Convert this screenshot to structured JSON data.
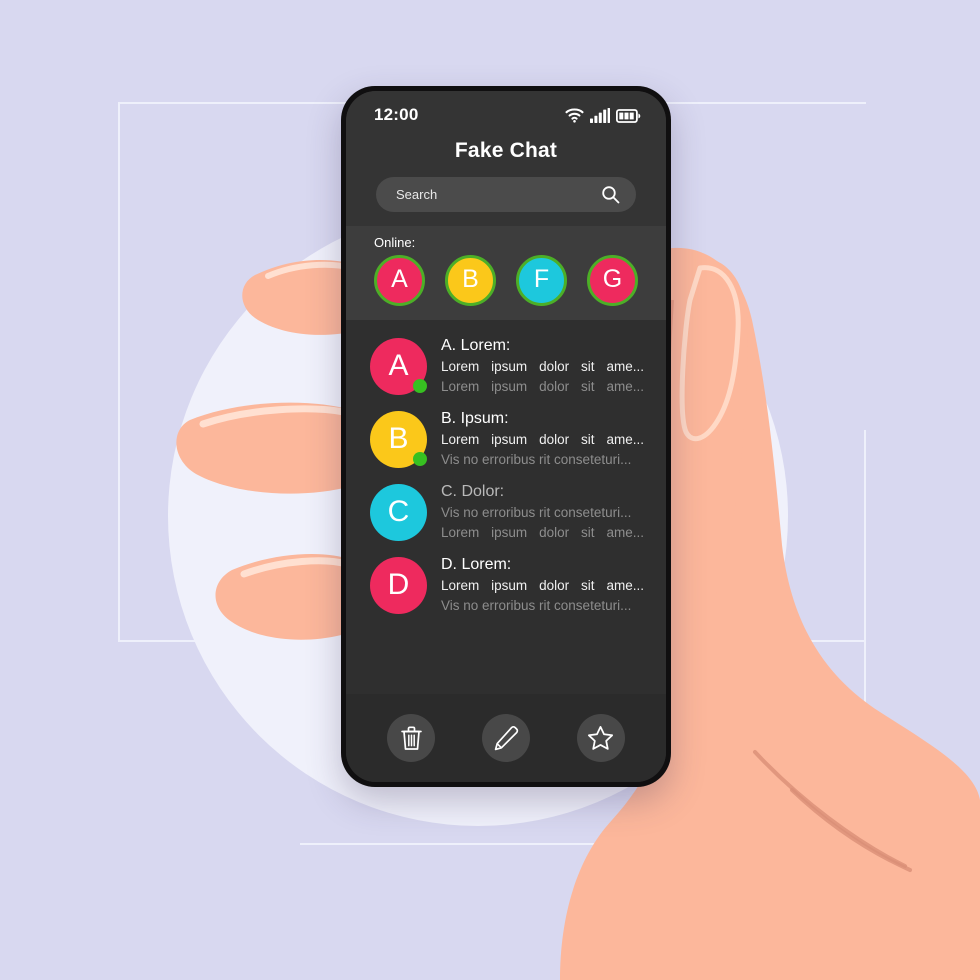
{
  "scene": {
    "background_color": "#d8d8f0",
    "circle_color": "#f0f1fb",
    "skin_color": "#fcb79b",
    "skin_shadow": "#f6a98c",
    "frame_line_color": "#eef0fb"
  },
  "phone": {
    "body_color": "#100f10",
    "screen_color": "#2f2f2f"
  },
  "statusbar": {
    "time": "12:00",
    "wifi_icon": "wifi-icon",
    "signal_icon": "signal-bars-icon",
    "battery_icon": "battery-icon"
  },
  "header": {
    "title": "Fake Chat",
    "background": "#343434"
  },
  "search": {
    "placeholder": "Search",
    "value": "",
    "icon": "search-icon"
  },
  "online": {
    "label": "Online:",
    "ring_color": "#4caf27",
    "avatars": [
      {
        "letter": "A",
        "color": "#ee2a5e"
      },
      {
        "letter": "B",
        "color": "#fbc81a"
      },
      {
        "letter": "F",
        "color": "#1dc8dd"
      },
      {
        "letter": "G",
        "color": "#ee2a5e"
      }
    ]
  },
  "chats": [
    {
      "letter": "A",
      "color": "#ee2a5e",
      "online": true,
      "title": "A. Lorem:",
      "unread": true,
      "line1": "Lorem ipsum dolor sit ame...",
      "line1_style": "strong",
      "line2": "Lorem ipsum dolor sit ame...",
      "line2_style": "dim",
      "justify1": true,
      "justify2": true
    },
    {
      "letter": "B",
      "color": "#fbc81a",
      "online": true,
      "title": "B. Ipsum:",
      "unread": true,
      "line1": "Lorem ipsum dolor sit ame...",
      "line1_style": "strong",
      "line2": "Vis no erroribus rit conseteturi...",
      "line2_style": "dim",
      "justify1": true,
      "justify2": false
    },
    {
      "letter": "C",
      "color": "#1dc8dd",
      "online": false,
      "title": "C. Dolor:",
      "unread": false,
      "line1": "Vis no erroribus rit conseteturi...",
      "line1_style": "dim",
      "line2": "Lorem ipsum dolor sit ame...",
      "line2_style": "dim",
      "justify1": false,
      "justify2": true
    },
    {
      "letter": "D",
      "color": "#ee2a5e",
      "online": false,
      "title": "D. Lorem:",
      "unread": true,
      "line1": "Lorem ipsum dolor sit ame...",
      "line1_style": "strong",
      "line2": "Vis no erroribus rit conseteturi...",
      "line2_style": "dim",
      "justify1": true,
      "justify2": false
    }
  ],
  "toolbar": {
    "buttons": [
      {
        "name": "delete-button",
        "icon": "trash-icon"
      },
      {
        "name": "compose-button",
        "icon": "pencil-icon"
      },
      {
        "name": "favorite-button",
        "icon": "star-icon"
      }
    ]
  }
}
